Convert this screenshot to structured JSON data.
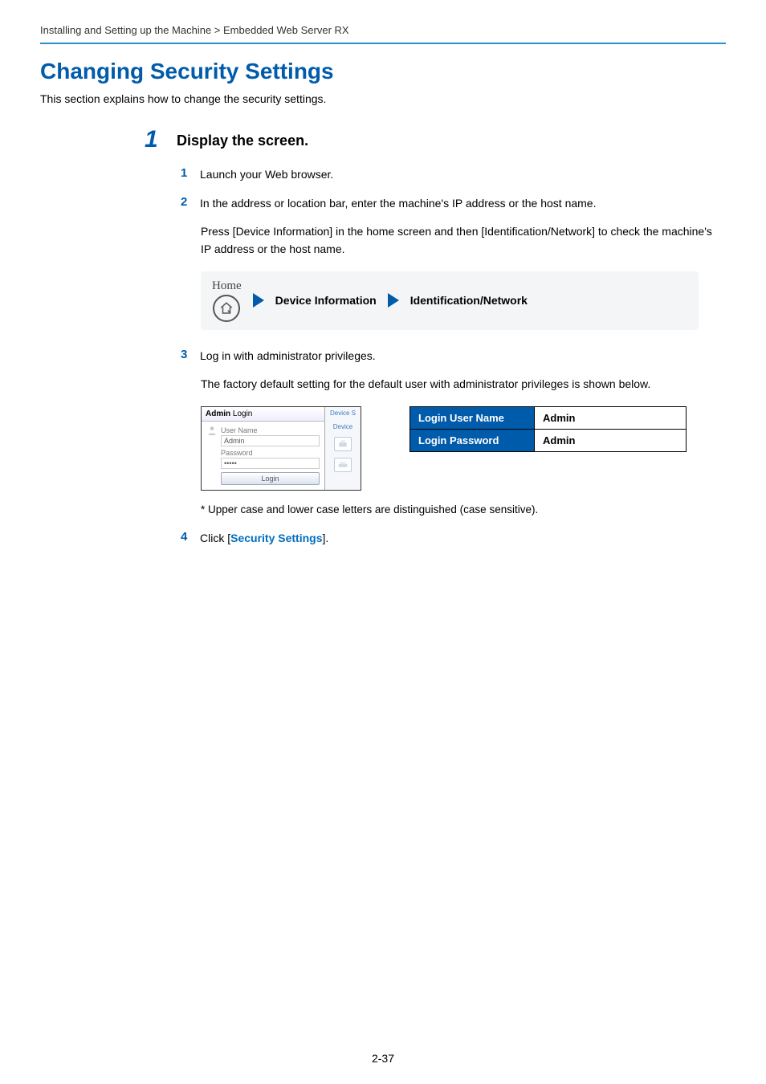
{
  "breadcrumb": "Installing and Setting up the Machine > Embedded Web Server RX",
  "heading": "Changing Security Settings",
  "intro": "This section explains how to change the security settings.",
  "step1": {
    "num": "1",
    "title": "Display the screen.",
    "items": {
      "s1": {
        "num": "1",
        "text": "Launch your Web browser."
      },
      "s2": {
        "num": "2",
        "text": "In the address or location bar, enter the machine's IP address or the host name."
      },
      "s2_note": "Press [Device Information] in the home screen and then [Identification/Network] to check the machine's IP address or the host name.",
      "nav": {
        "home": "Home",
        "a": "Device Information",
        "b": "Identification/Network"
      },
      "s3": {
        "num": "3",
        "text": "Log in with administrator privileges."
      },
      "s3_note": "The factory default setting for the default user with administrator privileges is shown below.",
      "login_shot": {
        "title_a": "Admin",
        "title_b": " Login",
        "right_top": "Device S",
        "user_lbl": "User Name",
        "user_val": "Admin",
        "pass_lbl": "Password",
        "pass_val": "•••••",
        "login_btn": "Login",
        "right_device": "Device"
      },
      "cred": {
        "row1_h": "Login User Name",
        "row1_v": "Admin",
        "row2_h": "Login Password",
        "row2_v": "Admin"
      },
      "case_note": "* Upper case and lower case letters are distinguished (case sensitive).",
      "s4": {
        "num": "4",
        "pre": "Click [",
        "link": "Security Settings",
        "post": "]."
      }
    }
  },
  "page_num": "2-37"
}
